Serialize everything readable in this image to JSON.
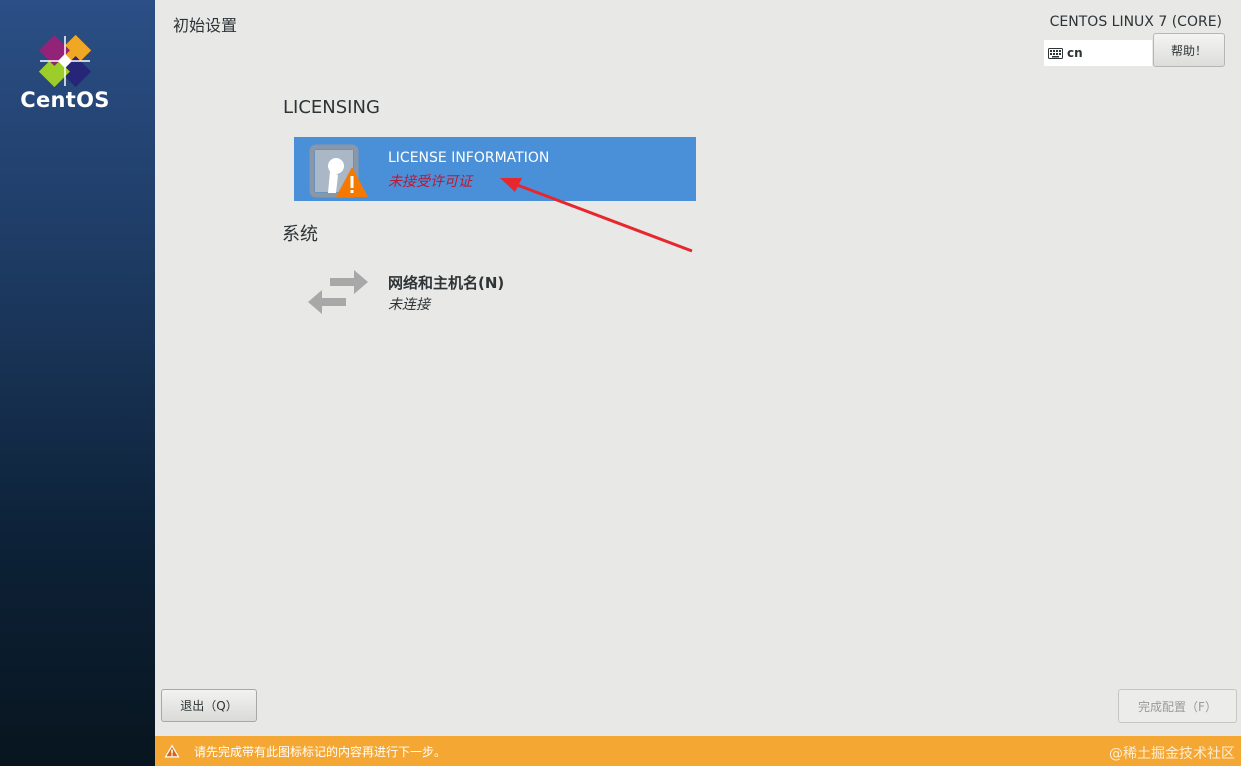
{
  "brand": {
    "name": "CentOS"
  },
  "header": {
    "title": "初始设置",
    "product": "CENTOS LINUX 7 (CORE)",
    "keyboard_layout": "cn",
    "help_label": "帮助！"
  },
  "sections": [
    {
      "title": "LICENSING",
      "spokes": [
        {
          "name": "LICENSE INFORMATION",
          "status": "未接受许可证",
          "icon": "license-warning-icon",
          "selected": true
        }
      ]
    },
    {
      "title": "系统",
      "spokes": [
        {
          "name": "网络和主机名(N)",
          "status": "未连接",
          "icon": "network-arrows-icon",
          "selected": false
        }
      ]
    }
  ],
  "footer": {
    "quit_label": "退出（Q）",
    "finish_label": "完成配置（F）",
    "warning": "请先完成带有此图标标记的内容再进行下一步。",
    "watermark": "@稀土掘金技术社区"
  },
  "colors": {
    "accent": "#4a90d9",
    "warning": "#f5a733",
    "error_text": "#c0152f",
    "annotation_arrow": "#e8262d"
  }
}
